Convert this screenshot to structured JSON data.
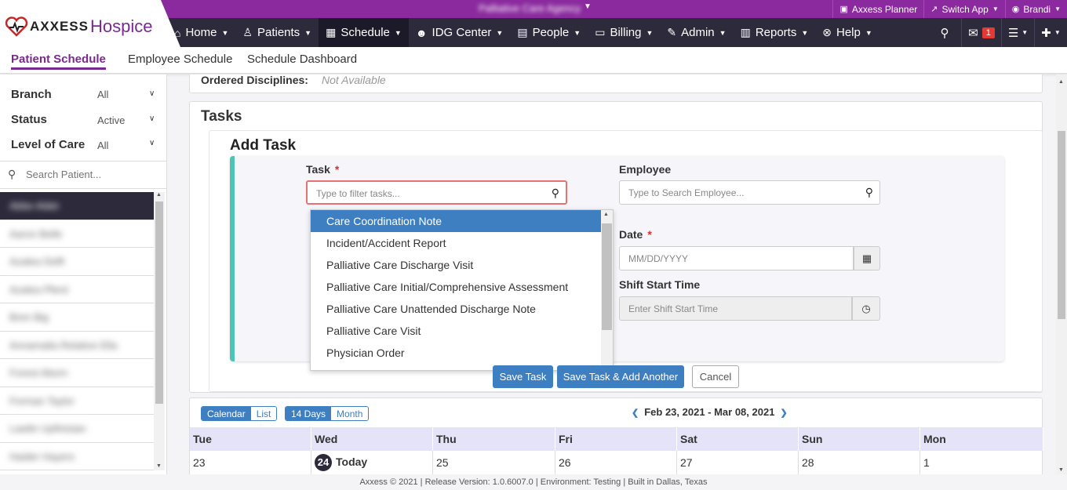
{
  "app": {
    "name_part1": "AXXESS",
    "name_part2": "Hospice",
    "agency": "Palliative Care Agency"
  },
  "toplinks": {
    "planner": "Axxess Planner",
    "switch_app": "Switch App",
    "user": "Brandi"
  },
  "nav": {
    "home": "Home",
    "patients": "Patients",
    "schedule": "Schedule",
    "idg": "IDG Center",
    "people": "People",
    "billing": "Billing",
    "admin": "Admin",
    "reports": "Reports",
    "help": "Help",
    "message_count": "1"
  },
  "subnav": {
    "patient_schedule": "Patient Schedule",
    "employee_schedule": "Employee Schedule",
    "schedule_dashboard": "Schedule Dashboard"
  },
  "sidebar": {
    "branch_label": "Branch",
    "branch_value": "All",
    "status_label": "Status",
    "status_value": "Active",
    "loc_label": "Level of Care",
    "loc_value": "All",
    "search_placeholder": "Search Patient...",
    "patients": [
      "Abbe Aldet",
      "Aaron Belle",
      "Azalea Delft",
      "Azalea Pferd",
      "Bren Big",
      "Annamalia Relative Ella",
      "Forest Aborn",
      "Forman Taylor",
      "Lawlin Upfinisian",
      "Haider Hayers"
    ]
  },
  "main": {
    "ordered_label": "Ordered Disciplines:",
    "ordered_value": "Not Available",
    "tasks_title": "Tasks",
    "add_task_title": "Add Task",
    "task_label": "Task",
    "task_placeholder": "Type to filter tasks...",
    "employee_label": "Employee",
    "employee_placeholder": "Type to Search Employee...",
    "date_label": "Date",
    "date_placeholder": "MM/DD/YYYY",
    "shift_label": "Shift Start Time",
    "shift_placeholder": "Enter Shift Start Time",
    "task_options": [
      "Care Coordination Note",
      "Incident/Accident Report",
      "Palliative Care Discharge Visit",
      "Palliative Care Initial/Comprehensive Assessment",
      "Palliative Care Unattended Discharge Note",
      "Palliative Care Visit",
      "Physician Order"
    ],
    "save_task": "Save Task",
    "save_add_another": "Save Task & Add Another",
    "cancel": "Cancel"
  },
  "calendar": {
    "view_calendar": "Calendar",
    "view_list": "List",
    "range_14": "14 Days",
    "range_month": "Month",
    "date_range": "Feb 23, 2021 - Mar 08, 2021",
    "days": [
      {
        "name": "Tue",
        "num": "23"
      },
      {
        "name": "Wed",
        "num": "24"
      },
      {
        "name": "Thu",
        "num": "25"
      },
      {
        "name": "Fri",
        "num": "26"
      },
      {
        "name": "Sat",
        "num": "27"
      },
      {
        "name": "Sun",
        "num": "28"
      },
      {
        "name": "Mon",
        "num": "1"
      }
    ],
    "today_label": "Today"
  },
  "footer": "Axxess © 2021 | Release Version: 1.0.6007.0 | Environment: Testing | Built in Dallas, Texas",
  "colors": {
    "topbar": "#8a2a9e",
    "navbar": "#2c2a3b",
    "accent_teal": "#4ec4b6",
    "primary_button": "#3d7fc1",
    "required": "#d32f2f"
  }
}
